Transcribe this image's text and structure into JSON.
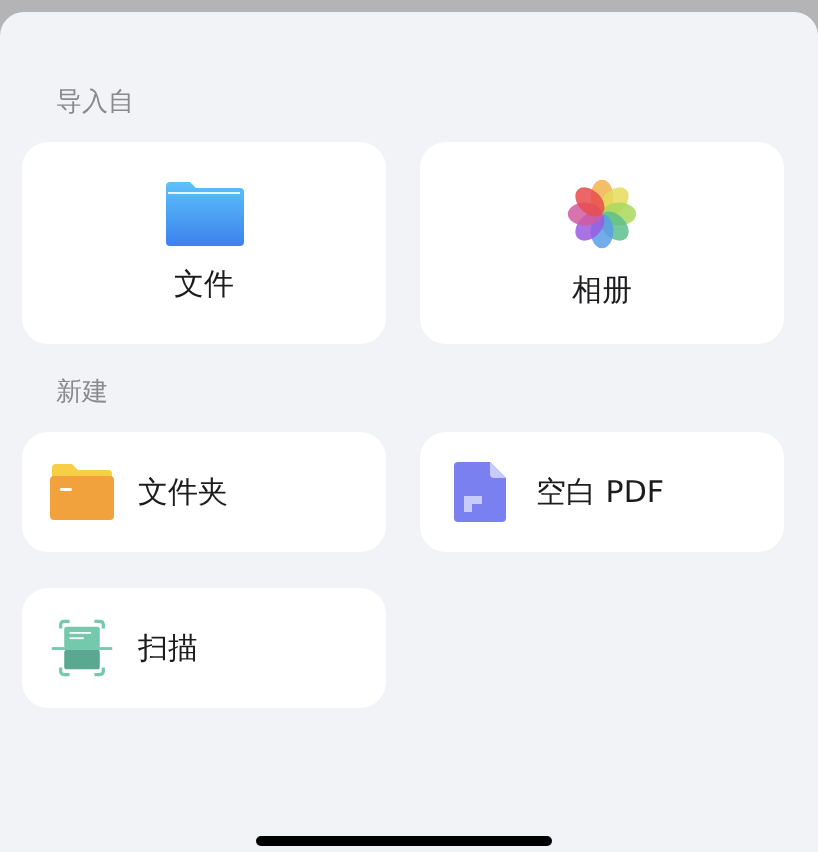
{
  "sections": [
    {
      "title": "导入自",
      "kind": "large",
      "items": [
        {
          "label": "文件",
          "kind": "files"
        },
        {
          "label": "相册",
          "kind": "photos"
        }
      ]
    },
    {
      "title": "新建",
      "kind": "row",
      "items": [
        {
          "label": "文件夹",
          "kind": "folder"
        },
        {
          "label": "空白 PDF",
          "kind": "pdf"
        },
        {
          "label": "扫描",
          "kind": "scan"
        }
      ]
    }
  ]
}
